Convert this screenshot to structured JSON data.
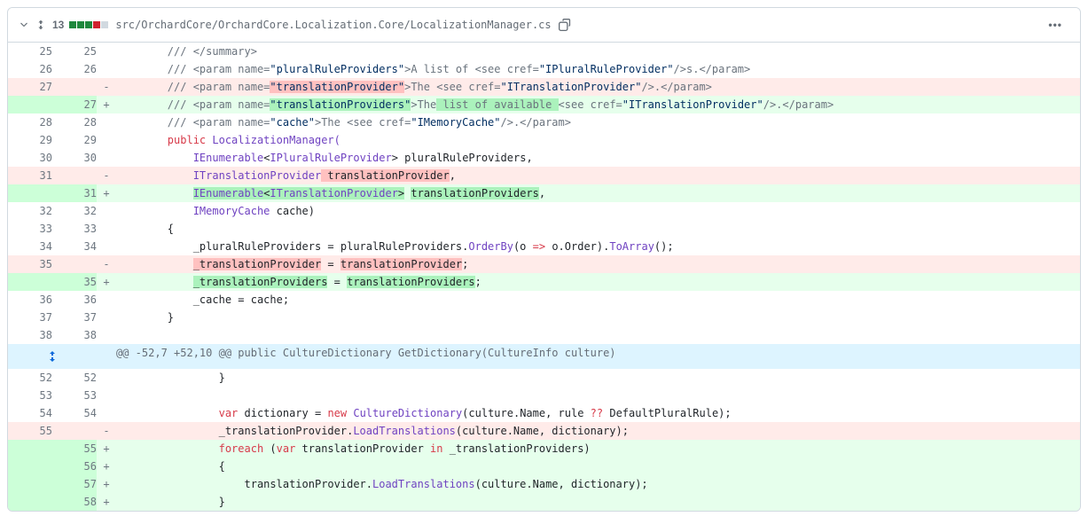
{
  "header": {
    "diffCount": "13",
    "filePath": "src/OrchardCore/OrchardCore.Localization.Core/LocalizationManager.cs",
    "menuDots": "•••"
  },
  "hunk": {
    "text": "@@ -52,7 +52,10 @@ public CultureDictionary GetDictionary(CultureInfo culture)"
  },
  "ln": {
    "L25": "25",
    "R25": "25",
    "L26": "26",
    "R26": "26",
    "L27": "27",
    "R27": "27",
    "L28": "28",
    "R28": "28",
    "L29": "29",
    "R29": "29",
    "L30": "30",
    "R30": "30",
    "L31": "31",
    "R31": "31",
    "L32": "32",
    "R32": "32",
    "L33": "33",
    "R33": "33",
    "L34": "34",
    "R34": "34",
    "L35": "35",
    "R35": "35",
    "L36": "36",
    "R36": "36",
    "L37": "37",
    "R37": "37",
    "L38": "38",
    "R38": "38",
    "L52": "52",
    "R52": "52",
    "L53": "53",
    "R53": "53",
    "L54": "54",
    "R54": "54",
    "L55": "55",
    "R55": "55",
    "R56": "56",
    "R57": "57",
    "R58": "58"
  },
  "c": {
    "indent2": "        ",
    "indent3": "            ",
    "indent4": "                ",
    "indent5": "                    ",
    "closeSummary": "/// </summary>",
    "openParam": "/// <param name=",
    "pluralAttr": "\"pluralRuleProviders\"",
    "pluralText": ">A list of <see cref=",
    "iplural": "\"IPluralRuleProvider\"",
    "closeSee": "/>s.</param>",
    "transOld": "\"translationProvider\"",
    "transOldText": ">The <see cref=",
    "itransprov": "\"ITranslationProvider\"",
    "closeParam": "/>.</param>",
    "transNew": "\"translationProviders\"",
    "transNewPre": ">The",
    "transNewHl": " list of available ",
    "transNewPost": "<see cref=",
    "cacheAttr": "\"cache\"",
    "cacheText": ">The <see cref=",
    "imemcache": "\"IMemoryCache\"",
    "public": "public",
    "locMgr": " LocalizationManager(",
    "ienum": "IEnumerable",
    "lt": "<",
    "gt": ">",
    "iplType": "IPluralRuleProvider",
    "space": " ",
    "pluralVar": "pluralRuleProviders",
    "comma": ",",
    "itransType": "ITranslationProvider",
    "transOldVar": " translationProvider",
    "transNewVar": "translationProviders",
    "imemType": "IMemoryCache",
    "cacheVar": "cache",
    "rparen": ")",
    "lbrace": "{",
    "rbrace": "}",
    "prpAssign": "_pluralRuleProviders = pluralRuleProviders.",
    "orderBy": "OrderBy",
    "lambdaStart": "(o ",
    "arrow": "=>",
    "lambdaEnd": " o.Order).",
    "toArray": "ToArray",
    "unit": "();",
    "oldTransA1": "_translationProvider",
    "eq": " = ",
    "oldTransA2": "translationProvider",
    "semi": ";",
    "newTransA1": "_translationProviders",
    "newTransA2": "translationProviders",
    "cacheAssign": "_cache = cache;",
    "var": "var",
    "dictVar": " dictionary = ",
    "new": "new",
    "cultDict": " CultureDictionary",
    "dictArgs": "(culture.Name, rule ",
    "qq": "??",
    "dictArgs2": " DefaultPluralRule);",
    "oldLoad1": "_translationProvider.",
    "loadTrans": "LoadTranslations",
    "loadArgs": "(culture.Name, dictionary);",
    "foreach": "foreach",
    "foreachOpen": " (",
    "tpVar": " translationProvider ",
    "in": "in",
    "tpColl": " _translationProviders)",
    "tpCall": "translationProvider.",
    "blank": ""
  }
}
